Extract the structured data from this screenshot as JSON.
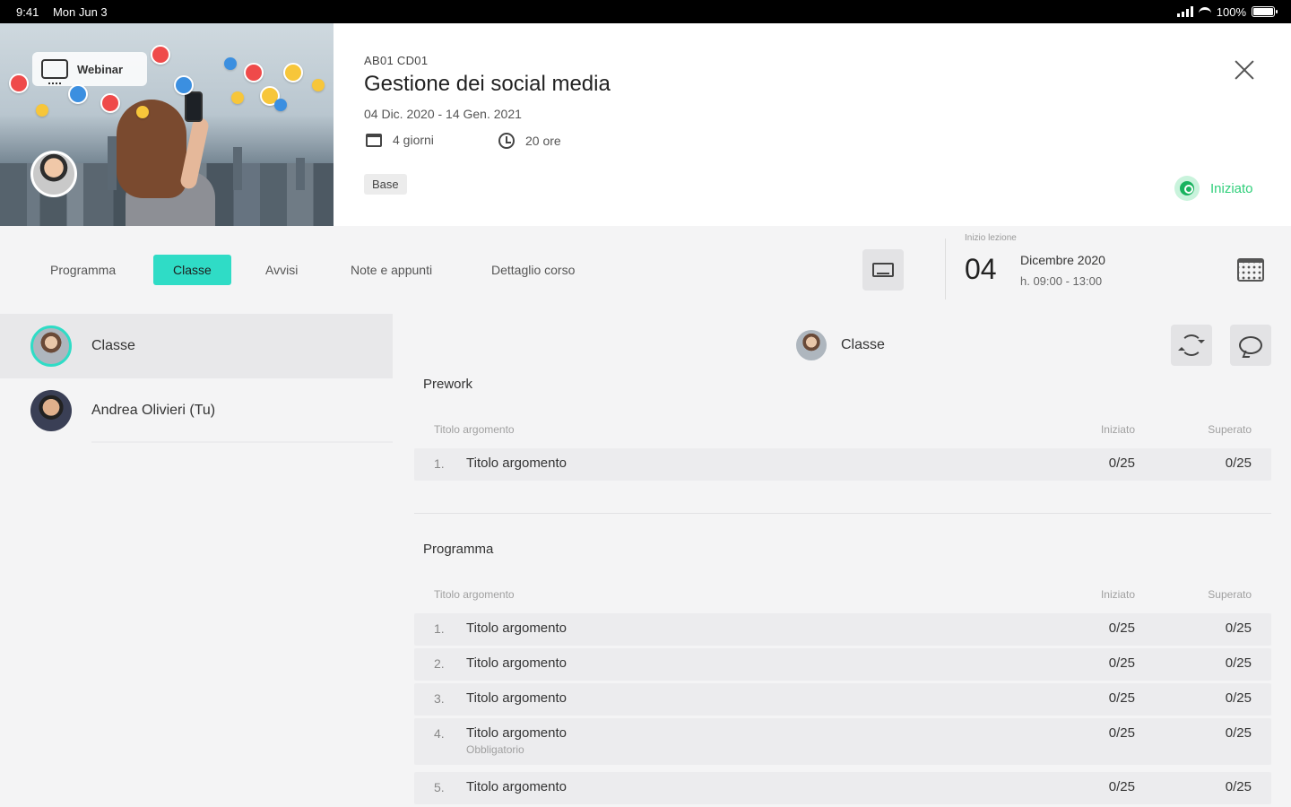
{
  "statusbar": {
    "time": "9:41",
    "date": "Mon Jun 3",
    "battery": "100%"
  },
  "header": {
    "webinar_label": "Webinar",
    "course_code": "AB01 CD01",
    "course_title": "Gestione dei social media",
    "course_dates": "04 Dic. 2020 - 14 Gen. 2021",
    "duration_days": "4 giorni",
    "duration_hours": "20 ore",
    "level": "Base",
    "status": "Iniziato",
    "status_color": "#19b35f"
  },
  "tabs": [
    {
      "label": "Programma"
    },
    {
      "label": "Classe"
    },
    {
      "label": "Avvisi"
    },
    {
      "label": "Note e appunti"
    },
    {
      "label": "Dettaglio corso"
    }
  ],
  "lesson": {
    "caption": "Inizio lezione",
    "day": "04",
    "month": "Dicembre 2020",
    "time": "h. 09:00 - 13:00"
  },
  "sidebar": {
    "items": [
      {
        "label": "Classe"
      },
      {
        "label": "Andrea Olivieri (Tu)"
      }
    ]
  },
  "main": {
    "title": "Classe",
    "prework": {
      "title": "Prework",
      "columns": [
        "Titolo argomento",
        "Iniziato",
        "Superato"
      ],
      "rows": [
        {
          "num": "1.",
          "name": "Titolo argomento",
          "started": "0/25",
          "passed": "0/25"
        }
      ]
    },
    "programma": {
      "title": "Programma",
      "columns": [
        "Titolo argomento",
        "Iniziato",
        "Superato"
      ],
      "rows": [
        {
          "num": "1.",
          "name": "Titolo argomento",
          "started": "0/25",
          "passed": "0/25"
        },
        {
          "num": "2.",
          "name": "Titolo argomento",
          "started": "0/25",
          "passed": "0/25"
        },
        {
          "num": "3.",
          "name": "Titolo argomento",
          "started": "0/25",
          "passed": "0/25"
        },
        {
          "num": "4.",
          "name": "Titolo argomento",
          "sub": "Obbligatorio",
          "started": "0/25",
          "passed": "0/25"
        },
        {
          "num": "5.",
          "name": "Titolo argomento",
          "started": "0/25",
          "passed": "0/25"
        }
      ]
    }
  },
  "colors": {
    "accent": "#2fdcc6",
    "status_green": "#2fcf7a"
  }
}
